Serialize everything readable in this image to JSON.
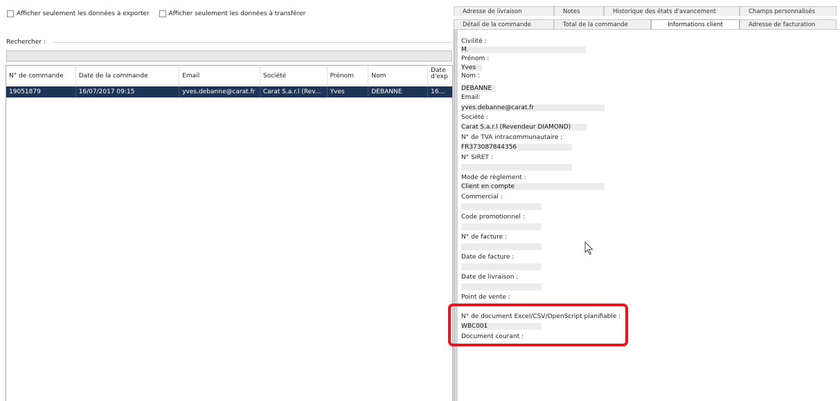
{
  "filters": {
    "export_only": "Afficher seulement les données à exporter",
    "transfer_only": "Afficher seulement les données à transférer"
  },
  "search": {
    "label": "Rechercher :",
    "value": ""
  },
  "table": {
    "headers": [
      "N° de commande",
      "Date de la commande",
      "Email",
      "Société",
      "Prénom",
      "Nom",
      "Date d'exp"
    ],
    "rows": [
      [
        "19051879",
        "16/07/2017 09:15",
        "yves.debanne@carat.fr",
        "Carat S.a.r.l (Rev...",
        "Yves",
        "DEBANNE",
        "16..."
      ]
    ]
  },
  "tabs": {
    "row1": [
      "Adresse de livraison",
      "Notes",
      "Historique des états d'avancement",
      "Champs personnalisés"
    ],
    "row2": [
      "Détail de la commande",
      "Total de la commande",
      "Informations client",
      "Adresse de facturation"
    ],
    "active": "Informations client"
  },
  "client": {
    "civilite_label": "Civilité :",
    "civilite": "M.",
    "prenom_label": "Prénom :",
    "prenom": "Yves",
    "nom_label": "Nom :",
    "nom": "DEBANNE",
    "email_label": "Email:",
    "email": "yves.debanne@carat.fr",
    "societe_label": "Société :",
    "societe": "Carat S.a.r.l (Revendeur DIAMOND)",
    "tva_label": "N° de TVA intracommunautaire :",
    "tva": "FR373087844356",
    "siret_label": "N° SIRET :",
    "siret": "",
    "reglement_label": "Mode de règlement :",
    "reglement": "Client en compte",
    "commercial_label": "Commercial :",
    "commercial": "",
    "promo_label": "Code promotionnel :",
    "promo": "",
    "facture_label": "N° de facture :",
    "facture": "",
    "date_facture_label": "Date de facture :",
    "date_facture": "",
    "date_livraison_label": "Date de livraison :",
    "date_livraison": "",
    "point_vente_label": "Point de vente :",
    "doc_label": "N° de document Excel/CSV/OpenScript planifiable :",
    "doc": "WBC001",
    "doc_courant_label": "Document courant :"
  },
  "colors": {
    "selection": "#1d3557",
    "highlight": "#e8161b"
  }
}
